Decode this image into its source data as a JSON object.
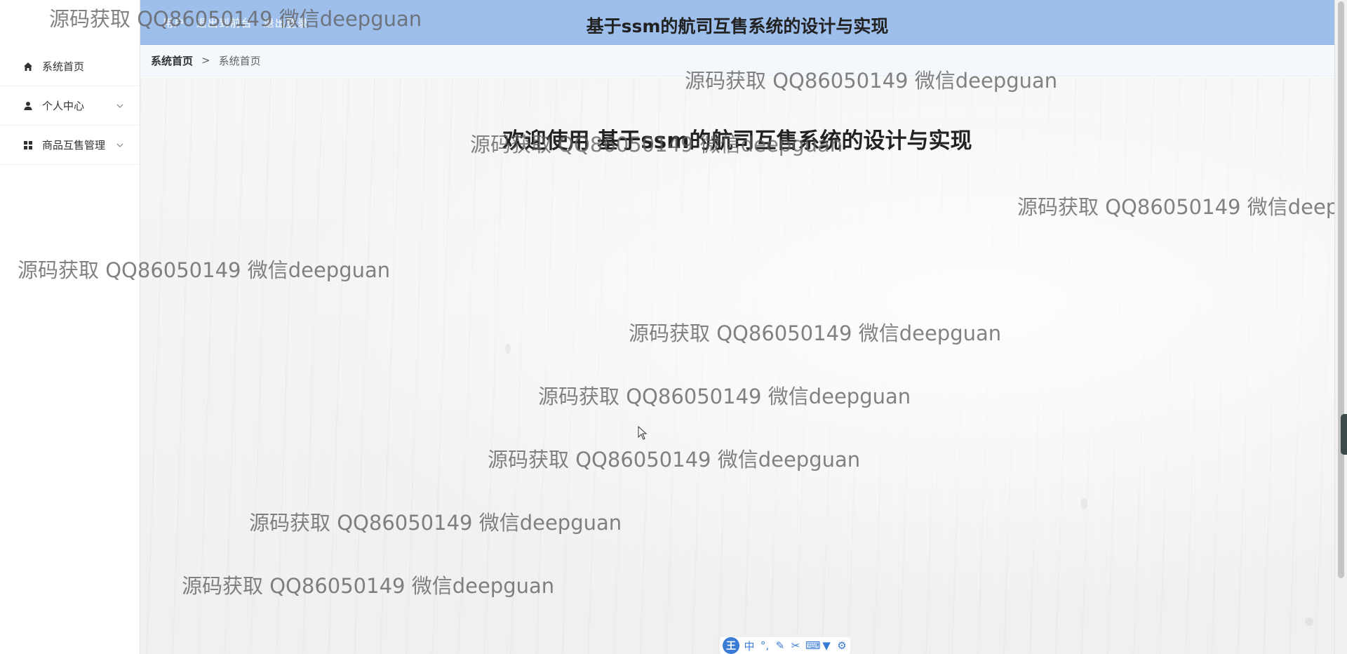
{
  "header": {
    "title": "基于ssm的航司互售系统的设计与实现",
    "user_links": [
      "用户",
      "退出到前台",
      "退出登录"
    ]
  },
  "sidebar": {
    "items": [
      {
        "label": "系统首页",
        "icon": "home-icon",
        "expandable": false
      },
      {
        "label": "个人中心",
        "icon": "user-icon",
        "expandable": true
      },
      {
        "label": "商品互售管理",
        "icon": "grid-icon",
        "expandable": true
      }
    ]
  },
  "breadcrumb": {
    "home": "系统首页",
    "separator": ">",
    "current": "系统首页"
  },
  "main": {
    "welcome": "欢迎使用 基于ssm的航司互售系统的设计与实现"
  },
  "watermark": {
    "text": "源码获取 QQ86050149 微信deepguan"
  },
  "ime_toolbar": {
    "logo": "王",
    "mode": "中",
    "icons": [
      "punctuation-icon",
      "pen-icon",
      "scissors-icon",
      "keyboard-icon",
      "shirt-icon",
      "settings-icon"
    ]
  },
  "colors": {
    "header_bg": "#9ebfeb",
    "breadcrumb_bg": "#f4f8fc",
    "ime_blue": "#3a7bd5"
  }
}
